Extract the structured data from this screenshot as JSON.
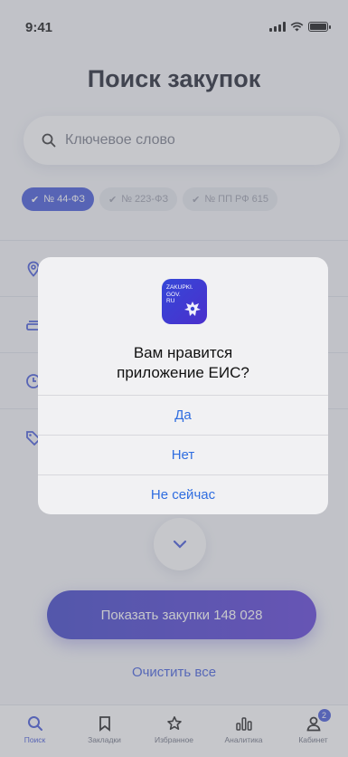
{
  "status_bar": {
    "time": "9:41"
  },
  "page_title": "Поиск закупок",
  "search": {
    "placeholder": "Ключевое слово"
  },
  "chips": [
    {
      "label": "№ 44-ФЗ",
      "active": true
    },
    {
      "label": "№ 223-ФЗ",
      "active": false
    },
    {
      "label": "№ ПП РФ 615",
      "active": false
    }
  ],
  "show_button": "Показать закупки 148 028",
  "clear_link": "Очистить все",
  "tabs": [
    {
      "label": "Поиск",
      "icon": "search-icon",
      "active": true
    },
    {
      "label": "Закладки",
      "icon": "bookmark-icon",
      "active": false
    },
    {
      "label": "Избранное",
      "icon": "star-icon",
      "active": false
    },
    {
      "label": "Аналитика",
      "icon": "bar-chart-icon",
      "active": false
    },
    {
      "label": "Кабинет",
      "icon": "person-icon",
      "active": false,
      "badge": "2"
    }
  ],
  "alert": {
    "logo_text": "ZAKUPKI.\nGOV.\nRU",
    "title_line1": "Вам нравится",
    "title_line2": "приложение ЕИС?",
    "buttons": [
      "Да",
      "Нет",
      "Не сейчас"
    ]
  },
  "colors": {
    "accent": "#4155d9",
    "alert_link": "#2f6de0"
  }
}
